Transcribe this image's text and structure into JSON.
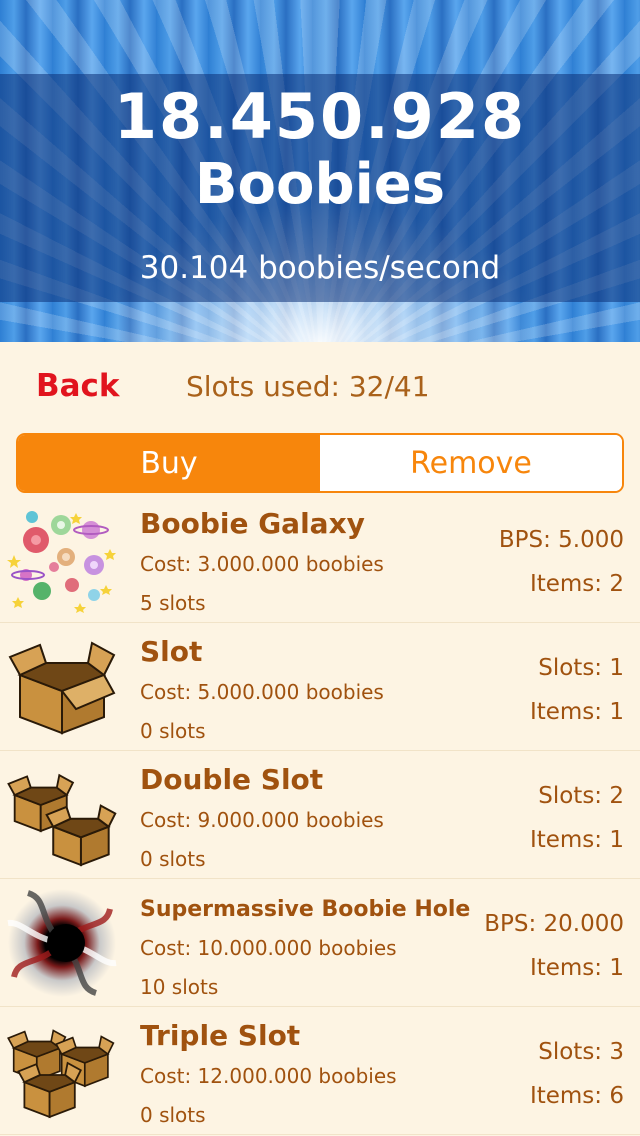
{
  "header": {
    "count": "18.450.928",
    "unit": "Boobies",
    "rate": "30.104 boobies/second"
  },
  "topbar": {
    "back_label": "Back",
    "slots_used": "Slots used: 32/41"
  },
  "segment": {
    "buy_label": "Buy",
    "remove_label": "Remove",
    "selected": "Buy"
  },
  "items": [
    {
      "name": "Boobie Galaxy",
      "cost": "Cost: 3.000.000 boobies",
      "slots": "5 slots",
      "stat1": "BPS: 5.000",
      "stat2": "Items: 2",
      "icon": "galaxy-icon"
    },
    {
      "name": "Slot",
      "cost": "Cost: 5.000.000 boobies",
      "slots": "0 slots",
      "stat1": "Slots: 1",
      "stat2": "Items: 1",
      "icon": "box-icon"
    },
    {
      "name": "Double Slot",
      "cost": "Cost: 9.000.000 boobies",
      "slots": "0 slots",
      "stat1": "Slots: 2",
      "stat2": "Items: 1",
      "icon": "double-box-icon"
    },
    {
      "name": "Supermassive Boobie Hole",
      "cost": "Cost: 10.000.000 boobies",
      "slots": "10 slots",
      "stat1": "BPS: 20.000",
      "stat2": "Items: 1",
      "icon": "black-hole-icon"
    },
    {
      "name": "Triple Slot",
      "cost": "Cost: 12.000.000 boobies",
      "slots": "0 slots",
      "stat1": "Slots: 3",
      "stat2": "Items: 6",
      "icon": "triple-box-icon"
    }
  ],
  "colors": {
    "accent": "#f7860c",
    "back": "#e1141e",
    "text": "#a0520f",
    "background": "#fdf4e3"
  }
}
